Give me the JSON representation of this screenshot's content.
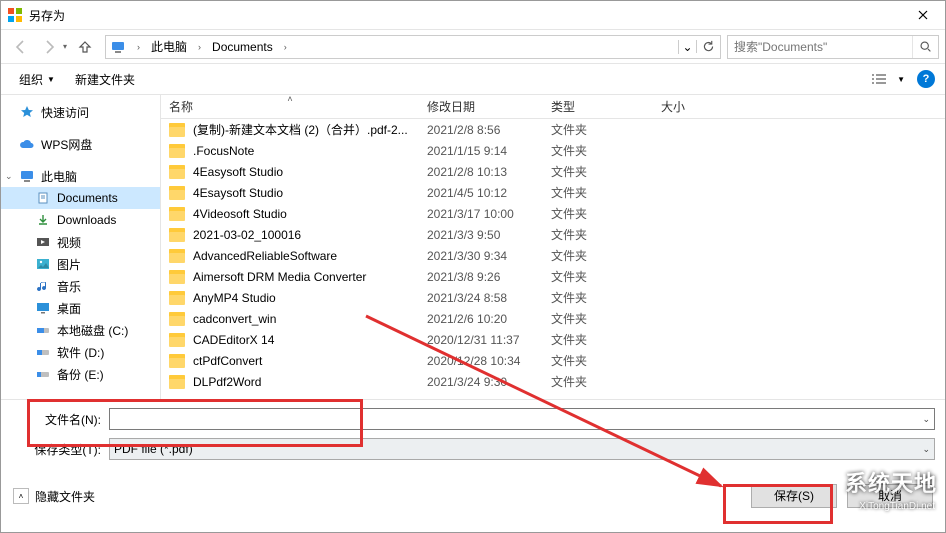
{
  "window": {
    "title": "另存为"
  },
  "nav": {
    "breadcrumb": [
      "此电脑",
      "Documents"
    ],
    "search_placeholder": "搜索\"Documents\""
  },
  "toolbar": {
    "organize": "组织",
    "newfolder": "新建文件夹"
  },
  "sidebar": {
    "quick": "快速访问",
    "wps": "WPS网盘",
    "thispc": "此电脑",
    "documents": "Documents",
    "downloads": "Downloads",
    "videos": "视频",
    "pictures": "图片",
    "music": "音乐",
    "desktop": "桌面",
    "cdrive": "本地磁盘 (C:)",
    "ddrive": "软件 (D:)",
    "edrive": "备份 (E:)"
  },
  "columns": {
    "name": "名称",
    "date": "修改日期",
    "type": "类型",
    "size": "大小"
  },
  "type_folder": "文件夹",
  "files": [
    {
      "name": "(复制)-新建文本文档 (2)（合并）.pdf-2...",
      "date": "2021/2/8 8:56"
    },
    {
      "name": ".FocusNote",
      "date": "2021/1/15 9:14"
    },
    {
      "name": "4Easysoft Studio",
      "date": "2021/2/8 10:13"
    },
    {
      "name": "4Esaysoft Studio",
      "date": "2021/4/5 10:12"
    },
    {
      "name": "4Videosoft Studio",
      "date": "2021/3/17 10:00"
    },
    {
      "name": "2021-03-02_100016",
      "date": "2021/3/3 9:50"
    },
    {
      "name": "AdvancedReliableSoftware",
      "date": "2021/3/30 9:34"
    },
    {
      "name": "Aimersoft DRM Media Converter",
      "date": "2021/3/8 9:26"
    },
    {
      "name": "AnyMP4 Studio",
      "date": "2021/3/24 8:58"
    },
    {
      "name": "cadconvert_win",
      "date": "2021/2/6 10:20"
    },
    {
      "name": "CADEditorX 14",
      "date": "2020/12/31 11:37"
    },
    {
      "name": "ctPdfConvert",
      "date": "2020/12/28 10:34"
    },
    {
      "name": "DLPdf2Word",
      "date": "2021/3/24 9:30"
    }
  ],
  "form": {
    "filename_label": "文件名(N):",
    "filename_value": "",
    "filetype_label": "保存类型(T):",
    "filetype_value": "PDF file (*.pdf)"
  },
  "footer": {
    "hide_folders": "隐藏文件夹",
    "save": "保存(S)",
    "cancel": "取消"
  },
  "watermark": {
    "brand": "系统天地",
    "url": "XiTongTianDi.net"
  }
}
